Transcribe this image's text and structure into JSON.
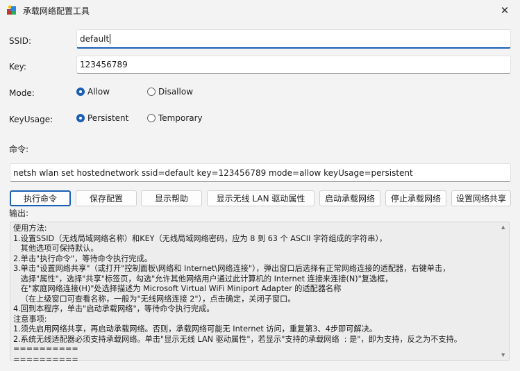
{
  "window": {
    "title": "承载网络配置工具",
    "close_glyph": "✕"
  },
  "form": {
    "ssid_label": "SSID:",
    "ssid_value": "default",
    "key_label": "Key:",
    "key_value": "123456789",
    "mode_label": "Mode:",
    "mode_options": [
      "Allow",
      "Disallow"
    ],
    "mode_selected": "Allow",
    "keyusage_label": "KeyUsage:",
    "keyusage_options": [
      "Persistent",
      "Temporary"
    ],
    "keyusage_selected": "Persistent",
    "command_label": "命令:",
    "command_value": "netsh wlan set hostednetwork ssid=default key=123456789 mode=allow keyUsage=persistent"
  },
  "buttons": [
    "执行命令",
    "保存配置",
    "显示帮助",
    "显示无线 LAN 驱动属性",
    "启动承载网络",
    "停止承载网络",
    "设置网络共享"
  ],
  "output": {
    "label": "输出:",
    "lines": [
      "使用方法:",
      "1.设置SSID（无线局域网络名称）和KEY（无线局域网络密码，应为 8 到 63 个 ASCII 字符组成的字符串），",
      "   其他选项可保持默认。",
      "2.单击\"执行命令\"，等待命令执行完成。",
      "3.单击\"设置网络共享\"（或打开\"控制面板\\网络和 Internet\\网络连接\"），弹出窗口后选择有正常网络连接的适配器，右键单击，",
      "   选择\"属性\"，选择\"共享\"标签页，勾选\"允许其他网络用户通过此计算机的 Internet 连接来连接(N)\"复选框，",
      "   在\"家庭网络连接(H)\"处选择描述为 Microsoft Virtual WiFi Miniport Adapter 的适配器名称",
      "   （在上级窗口可查看名称，一般为\"无线网络连接 2\"），点击确定，关闭子窗口。",
      "4.回到本程序，单击\"启动承载网络\"，等待命令执行完成。",
      "注意事项:",
      "1.须先启用网络共享，再启动承载网络。否则，承载网络可能无 Internet 访问，重复第3、4步即可解决。",
      "2.系统无线适配器必须支持承载网络。单击\"显示无线 LAN 驱动属性\"，若显示\"支持的承载网络  : 是\"，即为支持，反之为不支持。",
      "==========",
      "=========="
    ]
  },
  "icons": {
    "app": "network-app-icon",
    "close": "close-icon",
    "scroll_up": "scroll-up-arrow-icon",
    "scroll_down": "scroll-down-arrow-icon"
  },
  "colors": {
    "accent": "#1a5fb4",
    "background": "#f3f3f3",
    "output_bg": "#ededed"
  }
}
